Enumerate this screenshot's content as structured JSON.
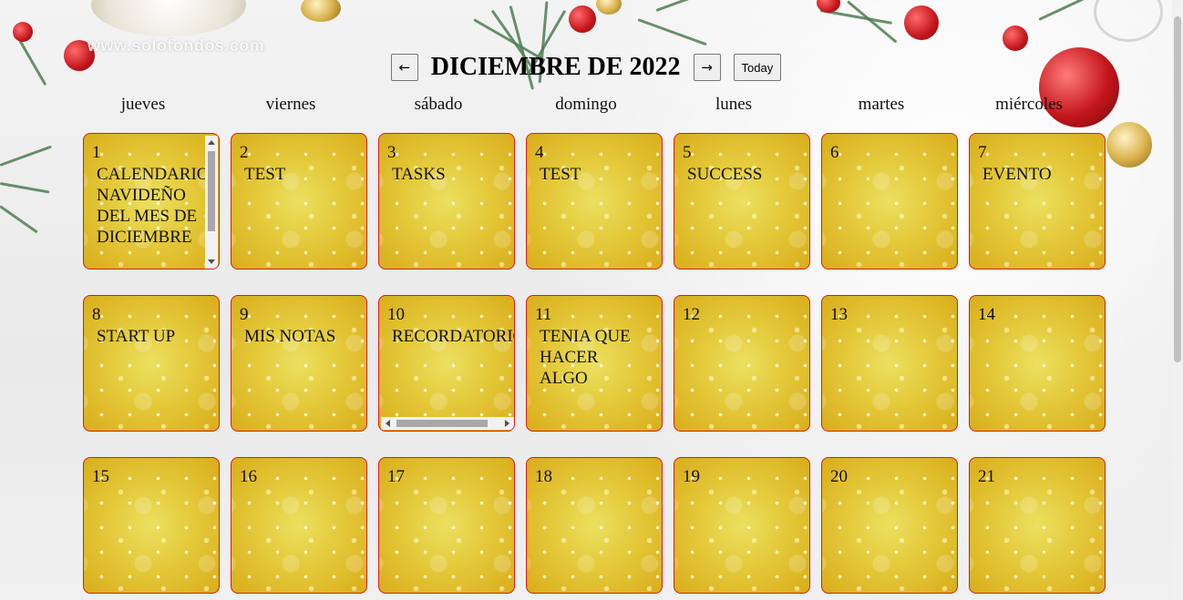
{
  "watermark": "www.solofondos.com",
  "header": {
    "prev_label": "←",
    "title": "DICIEMBRE DE 2022",
    "next_label": "→",
    "today_label": "Today"
  },
  "weekdays": [
    "jueves",
    "viernes",
    "sábado",
    "domingo",
    "lunes",
    "martes",
    "miércoles"
  ],
  "days": [
    {
      "num": "1",
      "text": "CALENDARIO NAVIDEÑO DEL MES DE DICIEMBRE"
    },
    {
      "num": "2",
      "text": "TEST"
    },
    {
      "num": "3",
      "text": "TASKS"
    },
    {
      "num": "4",
      "text": "TEST"
    },
    {
      "num": "5",
      "text": "SUCCESS"
    },
    {
      "num": "6",
      "text": ""
    },
    {
      "num": "7",
      "text": "EVENTO"
    },
    {
      "num": "8",
      "text": "START UP"
    },
    {
      "num": "9",
      "text": "MIS NOTAS"
    },
    {
      "num": "10",
      "text": "RECORDATORIO"
    },
    {
      "num": "11",
      "text": "TENIA QUE HACER ALGO"
    },
    {
      "num": "12",
      "text": ""
    },
    {
      "num": "13",
      "text": ""
    },
    {
      "num": "14",
      "text": ""
    },
    {
      "num": "15",
      "text": ""
    },
    {
      "num": "16",
      "text": ""
    },
    {
      "num": "17",
      "text": ""
    },
    {
      "num": "18",
      "text": ""
    },
    {
      "num": "19",
      "text": ""
    },
    {
      "num": "20",
      "text": ""
    },
    {
      "num": "21",
      "text": ""
    }
  ],
  "colors": {
    "cell_border": "#e0191a",
    "cell_gold": "#e4c93a",
    "ornament_red": "#c4161c",
    "ornament_gold": "#d8b04a",
    "pine": "#4f7d52"
  }
}
